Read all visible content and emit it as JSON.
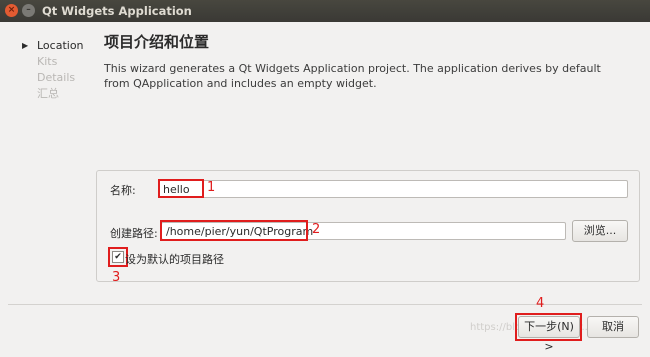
{
  "window": {
    "title": "Qt Widgets Application"
  },
  "sidebar": {
    "items": [
      {
        "label": "Location",
        "active": true
      },
      {
        "label": "Kits",
        "active": false
      },
      {
        "label": "Details",
        "active": false
      },
      {
        "label": "汇总",
        "active": false
      }
    ]
  },
  "page": {
    "title": "项目介绍和位置",
    "description": "This wizard generates a Qt Widgets Application project. The application derives by default from QApplication and includes an empty widget."
  },
  "form": {
    "name_label": "名称:",
    "name_value": "hello",
    "path_label": "创建路径:",
    "path_value": "/home/pier/yun/QtProgram",
    "browse_label": "浏览...",
    "default_checkbox_label": "设为默认的项目路径",
    "default_checked": true
  },
  "footer": {
    "next_label": "下一步(N) >",
    "cancel_label": "取消"
  },
  "annotations": {
    "n1": "1",
    "n2": "2",
    "n3": "3",
    "n4": "4",
    "color": "#e01d1d"
  },
  "watermark": "https://blog.csdn.net/y...stock"
}
